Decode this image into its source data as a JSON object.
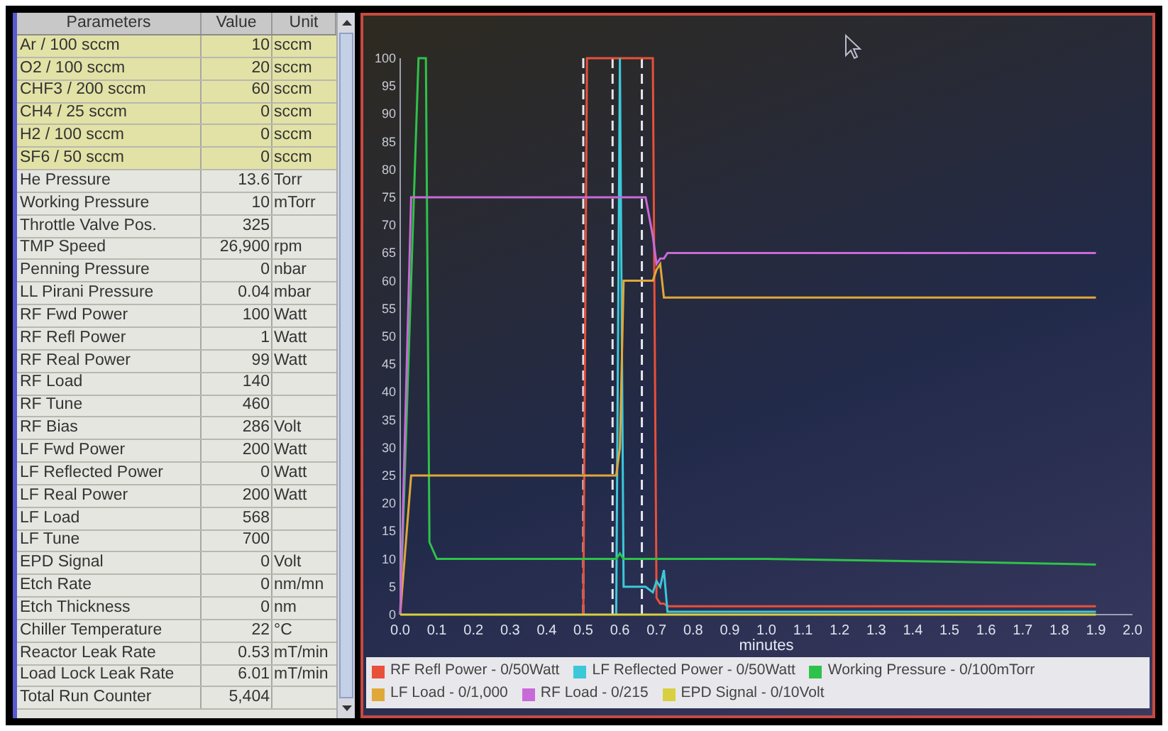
{
  "parameters_table": {
    "columns": [
      "Parameters",
      "Value",
      "Unit"
    ],
    "rows": [
      {
        "parameter": "Ar / 100 sccm",
        "value": "10",
        "unit": "sccm",
        "highlighted": true
      },
      {
        "parameter": "O2 / 100 sccm",
        "value": "20",
        "unit": "sccm",
        "highlighted": true
      },
      {
        "parameter": "CHF3 / 200 sccm",
        "value": "60",
        "unit": "sccm",
        "highlighted": true
      },
      {
        "parameter": "CH4 / 25 sccm",
        "value": "0",
        "unit": "sccm",
        "highlighted": true
      },
      {
        "parameter": "H2 / 100 sccm",
        "value": "0",
        "unit": "sccm",
        "highlighted": true
      },
      {
        "parameter": "SF6 / 50 sccm",
        "value": "0",
        "unit": "sccm",
        "highlighted": true
      },
      {
        "parameter": "He Pressure",
        "value": "13.6",
        "unit": "Torr",
        "highlighted": false
      },
      {
        "parameter": "Working Pressure",
        "value": "10",
        "unit": "mTorr",
        "highlighted": false
      },
      {
        "parameter": "Throttle Valve Pos.",
        "value": "325",
        "highlighted": false
      },
      {
        "parameter": "TMP Speed",
        "value": "26,900",
        "unit": "rpm",
        "highlighted": false
      },
      {
        "parameter": "Penning Pressure",
        "value": "0",
        "unit": "nbar",
        "highlighted": false
      },
      {
        "parameter": "LL Pirani Pressure",
        "value": "0.04",
        "unit": "mbar",
        "highlighted": false
      },
      {
        "parameter": "RF Fwd Power",
        "value": "100",
        "unit": "Watt",
        "highlighted": false
      },
      {
        "parameter": "RF Refl Power",
        "value": "1",
        "unit": "Watt",
        "highlighted": false
      },
      {
        "parameter": "RF Real Power",
        "value": "99",
        "unit": "Watt",
        "highlighted": false
      },
      {
        "parameter": "RF Load",
        "value": "140",
        "highlighted": false
      },
      {
        "parameter": "RF Tune",
        "value": "460",
        "highlighted": false
      },
      {
        "parameter": "RF Bias",
        "value": "286",
        "unit": "Volt",
        "highlighted": false
      },
      {
        "parameter": "LF Fwd Power",
        "value": "200",
        "unit": "Watt",
        "highlighted": false
      },
      {
        "parameter": "LF Reflected Power",
        "value": "0",
        "unit": "Watt",
        "highlighted": false
      },
      {
        "parameter": "LF Real Power",
        "value": "200",
        "unit": "Watt",
        "highlighted": false
      },
      {
        "parameter": "LF Load",
        "value": "568",
        "highlighted": false
      },
      {
        "parameter": "LF Tune",
        "value": "700",
        "highlighted": false
      },
      {
        "parameter": "EPD Signal",
        "value": "0",
        "unit": "Volt",
        "highlighted": false
      },
      {
        "parameter": "Etch Rate",
        "value": "0",
        "unit": "nm/mn",
        "highlighted": false
      },
      {
        "parameter": "Etch Thickness",
        "value": "0",
        "unit": "nm",
        "highlighted": false
      },
      {
        "parameter": "Chiller Temperature",
        "value": "22",
        "unit": "°C",
        "highlighted": false
      },
      {
        "parameter": "Reactor Leak Rate",
        "value": "0.53",
        "unit": "mT/min",
        "highlighted": false
      },
      {
        "parameter": "Load Lock Leak Rate",
        "value": "6.01",
        "unit": "mT/min",
        "highlighted": false
      },
      {
        "parameter": "Total Run Counter",
        "value": "5,404",
        "highlighted": false
      }
    ]
  },
  "chart": {
    "chart_data": {
      "type": "line",
      "xlabel": "minutes",
      "x": [
        0,
        0.03,
        0.05,
        0.06,
        0.07,
        0.08,
        0.1,
        0.5,
        0.51,
        0.59,
        0.6,
        0.61,
        0.67,
        0.69,
        0.7,
        0.71,
        0.72,
        0.73,
        1.0,
        1.5,
        1.9
      ],
      "xlim": [
        0,
        2
      ],
      "ylim": [
        0,
        100
      ],
      "xticks": [
        {
          "value": 0,
          "label": "0.0"
        },
        0.1,
        0.2,
        0.3,
        0.4,
        0.5,
        0.6,
        0.7,
        0.8,
        0.9,
        {
          "value": 1,
          "label": "1.0"
        },
        1.1,
        1.2,
        1.3,
        1.4,
        1.5,
        1.6,
        1.7,
        1.8,
        1.9,
        {
          "value": 2,
          "label": "2.0"
        }
      ],
      "legend": "bottom",
      "yticks": [
        0,
        5,
        10,
        15,
        20,
        25,
        30,
        35,
        40,
        45,
        50,
        55,
        60,
        65,
        70,
        75,
        80,
        85,
        90,
        95,
        100
      ],
      "series": [
        {
          "name": "RF Refl Power - 0/50Watt",
          "color": "#e8503a",
          "values": [
            null,
            null,
            null,
            null,
            null,
            null,
            null,
            0,
            100,
            100,
            100,
            100,
            100,
            100,
            3,
            2,
            2,
            1.5,
            1.5,
            1.5,
            1.5
          ]
        },
        {
          "name": "LF Reflected Power - 0/50Watt",
          "color": "#3cc8d8",
          "values": [
            null,
            null,
            null,
            null,
            null,
            null,
            null,
            null,
            null,
            0,
            100,
            5,
            5,
            4,
            6,
            5,
            8,
            0.5,
            0.5,
            0.5,
            0.5
          ]
        },
        {
          "name": "Working Pressure - 0/100mTorr",
          "color": "#2ec24a",
          "values": [
            0,
            60,
            100,
            100,
            100,
            13,
            10,
            10,
            10,
            10,
            11,
            10,
            10,
            10,
            10,
            10,
            10,
            10,
            10,
            9.5,
            9
          ]
        },
        {
          "name": "LF Load - 0/1,000",
          "color": "#e0a838",
          "values": [
            0,
            25,
            25,
            25,
            25,
            25,
            25,
            25,
            25,
            25,
            30,
            60,
            60,
            60,
            62,
            63,
            57,
            57,
            57,
            57,
            57
          ]
        },
        {
          "name": "RF Load - 0/215",
          "color": "#c86ad8",
          "values": [
            0,
            75,
            75,
            75,
            75,
            75,
            75,
            75,
            75,
            75,
            75,
            75,
            75,
            68,
            63,
            64,
            64,
            65,
            65,
            65,
            65
          ]
        },
        {
          "name": "EPD Signal - 0/10Volt",
          "color": "#d8d040",
          "values": [
            0,
            0,
            0,
            0,
            0,
            0,
            0,
            0,
            0,
            0,
            0,
            0,
            0,
            0,
            0,
            0,
            0,
            0,
            0,
            0,
            0
          ]
        }
      ],
      "ref_lines": [
        {
          "axis": "x",
          "value": 0.5
        },
        {
          "axis": "x",
          "value": 0.58
        },
        {
          "axis": "x",
          "value": 0.66
        }
      ]
    }
  }
}
